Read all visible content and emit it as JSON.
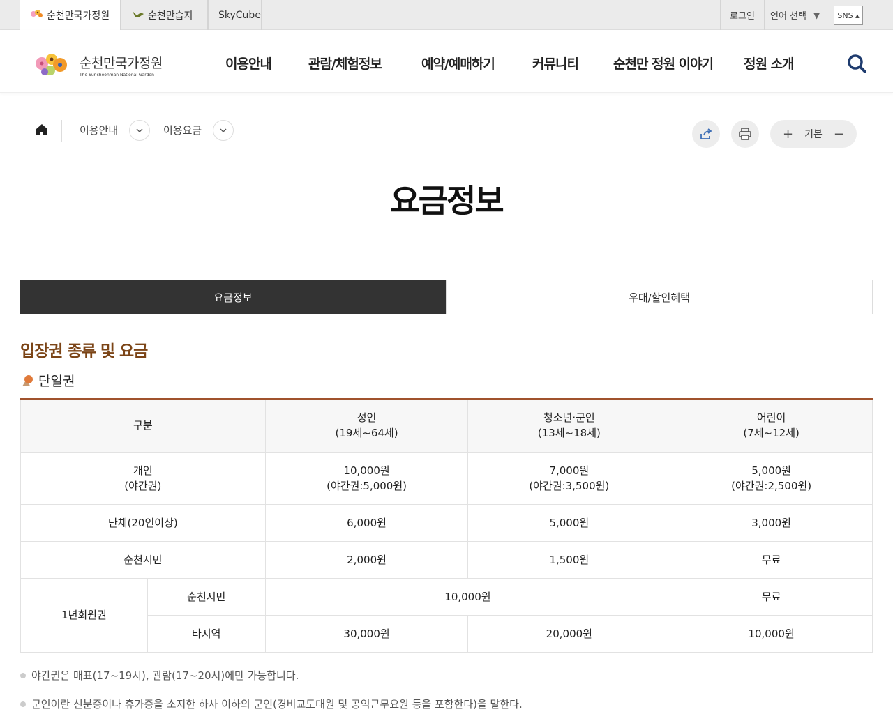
{
  "topbar": {
    "sites": [
      {
        "label": "순천만국가정원",
        "icon": "flower-icon"
      },
      {
        "label": "순천만습지",
        "icon": "bird-icon"
      },
      {
        "label": "SkyCube",
        "icon": ""
      }
    ],
    "login": "로그인",
    "language": "언어 선택",
    "language_arrow": "▼",
    "sns": "SNS ▴"
  },
  "header": {
    "logo_ko": "순천만국가정원",
    "logo_en": "The Suncheonman National Garden",
    "nav": [
      "이용안내",
      "관람/체험정보",
      "예약/예매하기",
      "커뮤니티",
      "순천만 정원 이야기",
      "정원 소개"
    ]
  },
  "breadcrumb": {
    "level1": "이용안내",
    "level2": "이용요금"
  },
  "zoom": {
    "plus": "+",
    "label": "기본",
    "minus": "−"
  },
  "page_title": "요금정보",
  "tabs": [
    "요금정보",
    "우대/할인혜택"
  ],
  "section_title": "입장권 종류 및 요금",
  "sub_title": "단일권",
  "table": {
    "head": {
      "category": "구분",
      "adult": "성인",
      "adult_age": "(19세~64세)",
      "youth": "청소년·군인",
      "youth_age": "(13세~18세)",
      "child": "어린이",
      "child_age": "(7세~12세)"
    },
    "rows": {
      "individual": {
        "label": "개인",
        "label2": "(야간권)",
        "adult": "10,000원",
        "adult_night": "(야간권:5,000원)",
        "youth": "7,000원",
        "youth_night": "(야간권:3,500원)",
        "child": "5,000원",
        "child_night": "(야간권:2,500원)"
      },
      "group": {
        "label": "단체(20인이상)",
        "adult": "6,000원",
        "youth": "5,000원",
        "child": "3,000원"
      },
      "citizen": {
        "label": "순천시민",
        "adult": "2,000원",
        "youth": "1,500원",
        "child": "무료"
      },
      "annual": {
        "label": "1년회원권",
        "citizen_label": "순천시민",
        "citizen_adult_youth": "10,000원",
        "citizen_child": "무료",
        "other_label": "타지역",
        "other_adult": "30,000원",
        "other_youth": "20,000원",
        "other_child": "10,000원"
      }
    }
  },
  "notes": [
    "야간권은 매표(17~19시), 관람(17~20시)에만 가능합니다.",
    "군인이란 신분증이나 휴가증을 소지한 하사 이하의 군인(경비교도대원 및 공익근무요원 등을 포함한다)을 말한다."
  ],
  "colors": {
    "accent": "#7b4416",
    "table_top_border": "#a0522d",
    "active_tab": "#333333"
  }
}
